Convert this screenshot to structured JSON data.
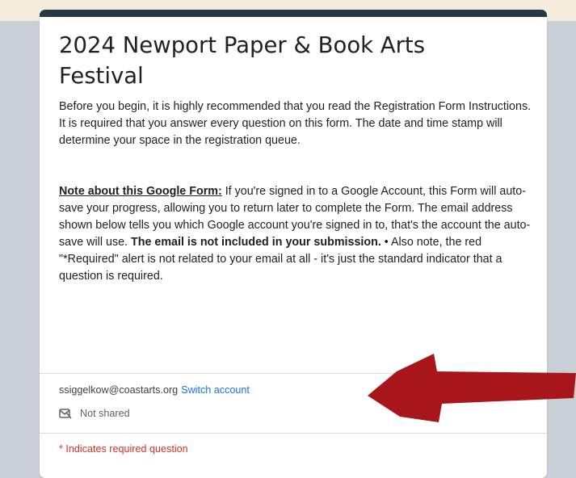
{
  "form": {
    "title": "2024 Newport Paper & Book Arts Festival",
    "intro": "Before you begin, it is highly recommended that you read the Registration Form Instructions. It is required that you answer every question on this form. The date and time stamp will determine your space in the registration queue.",
    "note_heading": "Note about this Google Form:",
    "note_text": " If you're signed in to a Google Account, this Form will auto-save your progress, allowing you to return later to complete the Form. The email address shown below tells you which Google account you're signed in to, that's the account the auto-save will use. ",
    "note_bold": "The email is not included in your submission.",
    "note_tail": " •  Also note, the red \"*Required\" alert is not related to your email at all - it's just the standard indicator that a question is required."
  },
  "account": {
    "email": "ssiggelkow@coastarts.org",
    "switch_label": "Switch account",
    "sharing_status": "Not shared",
    "sharing_icon": "not-shared-icon",
    "save_icon": "cloud-icon"
  },
  "required_note": "* Indicates required question",
  "colors": {
    "header_bar": "#263746",
    "link": "#1a73e8",
    "required": "#d93025",
    "arrow": "#a8161b",
    "background": "#c9cfd6",
    "top_strip": "#f6ecdd"
  }
}
